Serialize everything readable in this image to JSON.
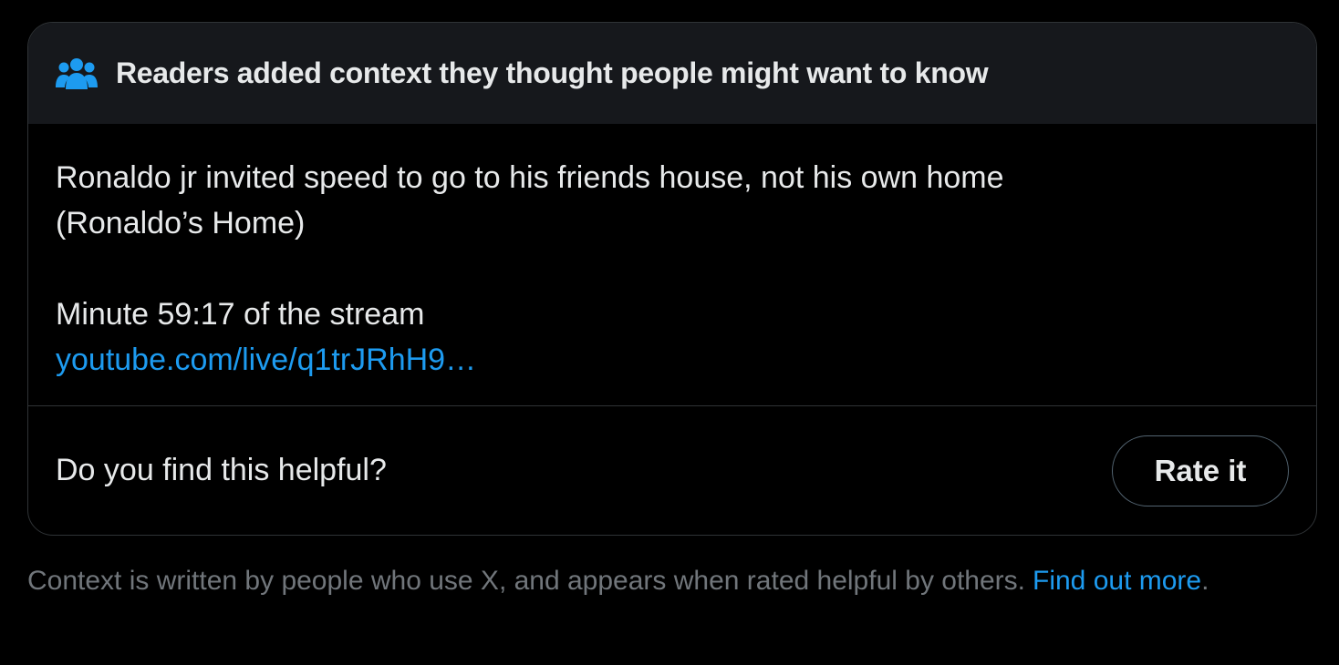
{
  "card": {
    "header": {
      "icon": "people-icon",
      "title": "Readers added context they thought people might want to know"
    },
    "body": {
      "line1": "Ronaldo jr invited speed to go to his friends house, not his own home",
      "line2": "(Ronaldo’s Home)",
      "line3": "Minute 59:17 of the stream",
      "link_text": "youtube.com/live/q1trJRhH9…"
    },
    "footer": {
      "question": "Do you find this helpful?",
      "rate_label": "Rate it"
    }
  },
  "note": {
    "text": "Context is written by people who use X, and appears when rated helpful by others.",
    "link_text": "Find out more",
    "trailing": "."
  },
  "colors": {
    "background": "#000000",
    "header_bg": "#16181c",
    "text_primary": "#e7e9ea",
    "text_secondary": "#71767b",
    "link": "#1d9bf0",
    "border": "#2f3336"
  }
}
